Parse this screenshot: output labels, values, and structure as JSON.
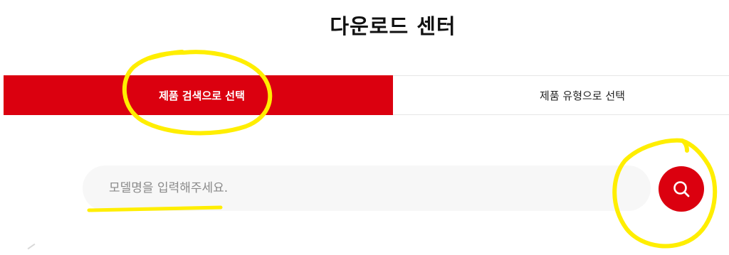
{
  "header": {
    "title": "다운로드 센터"
  },
  "tabs": [
    {
      "label": "제품 검색으로 선택",
      "active": true
    },
    {
      "label": "제품 유형으로 선택",
      "active": false
    }
  ],
  "search": {
    "value": "",
    "placeholder": "모델명을 입력해주세요.",
    "button_icon": "search-icon"
  },
  "colors": {
    "accent": "#db000f",
    "input_bg": "#f7f7f7",
    "annotation": "#ffee00"
  }
}
